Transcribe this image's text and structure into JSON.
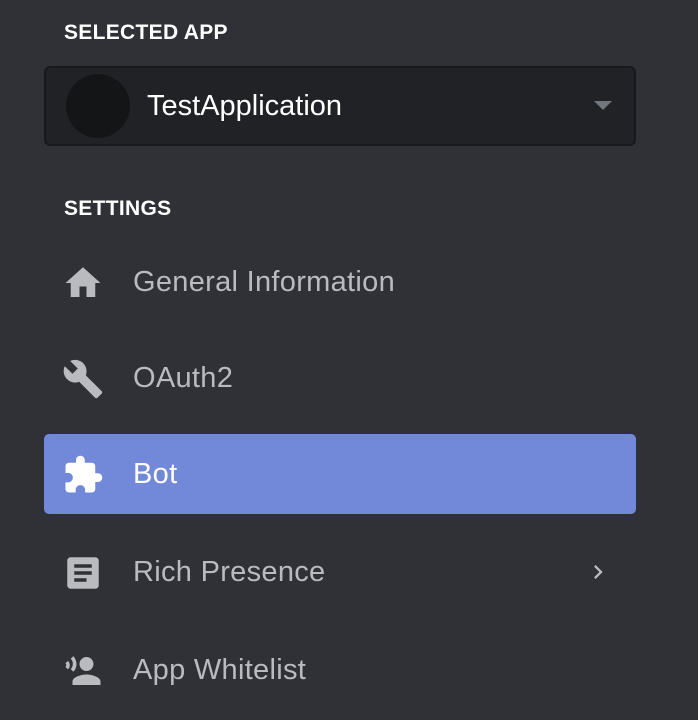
{
  "selected_app": {
    "heading": "SELECTED APP",
    "app_name": "TestApplication",
    "icon": "chevron-down-icon"
  },
  "settings": {
    "heading": "SETTINGS",
    "items": [
      {
        "label": "General Information",
        "icon": "home-icon",
        "active": false
      },
      {
        "label": "OAuth2",
        "icon": "wrench-icon",
        "active": false
      },
      {
        "label": "Bot",
        "icon": "puzzle-icon",
        "active": true
      },
      {
        "label": "Rich Presence",
        "icon": "document-icon",
        "active": false,
        "has_submenu": true
      },
      {
        "label": "App Whitelist",
        "icon": "person-icon",
        "active": false
      }
    ]
  },
  "colors": {
    "background": "#2f3136",
    "select_background": "#202225",
    "active_item": "#7289da",
    "text_primary": "#ffffff",
    "text_muted": "#b9bbbe",
    "icon_muted": "#b9bbbe"
  }
}
